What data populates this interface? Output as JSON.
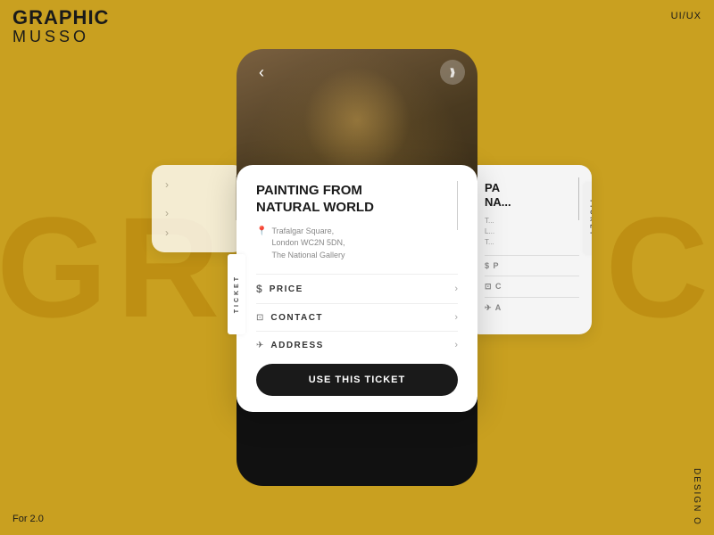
{
  "brand": {
    "graphic": "GRAPHIC",
    "musso": "MUSSO"
  },
  "labels": {
    "uiux": "UI/UX",
    "for_version": "For 2.0",
    "design": "DESIGN O"
  },
  "watermark": {
    "text": "GRAPHIC"
  },
  "ticket": {
    "title_line1": "PAINTING FROM",
    "title_line2": "NATURAL WORLD",
    "location_line1": "Trafalgar Square,",
    "location_line2": "London WC2N 5DN,",
    "location_line3": "The National Gallery",
    "rows": [
      {
        "icon": "$",
        "label": "PRICE"
      },
      {
        "icon": "✉",
        "label": "CONTACT"
      },
      {
        "icon": "✈",
        "label": "ADDRESS"
      }
    ],
    "cta_label": "USE THIS TICKET",
    "ticket_side_label": "TICKET"
  },
  "peek_card": {
    "title_line1": "PA",
    "title_line2": "NA...",
    "ticket_label": "TICKET",
    "rows": [
      "$ P",
      "✉ C",
      "✈ A"
    ]
  },
  "nav": {
    "back_icon": "‹",
    "info_icon": "⟫"
  }
}
